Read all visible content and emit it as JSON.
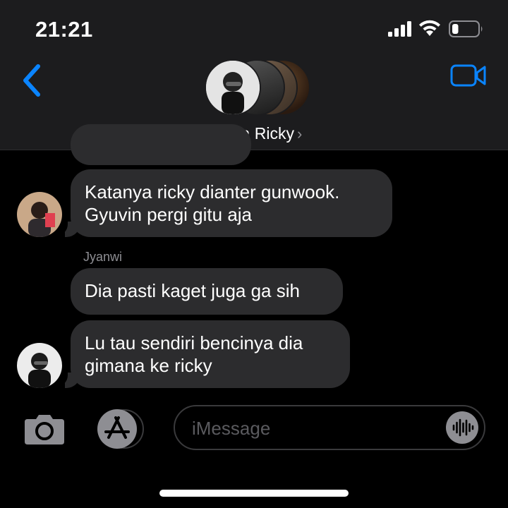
{
  "status_bar": {
    "time": "21:21",
    "battery_level": 0.25
  },
  "header": {
    "title": "Tanpa Ricky",
    "title_chevron": "›",
    "icons": [
      "back-chevron-icon",
      "video-camera-icon"
    ]
  },
  "messages": [
    {
      "text_lines": [
        "Katanya ricky dianter gunwook.",
        "Gyuvin pergi gitu aja"
      ]
    },
    {
      "sender": "Jyanwi",
      "text_lines": [
        "Dia pasti kaget juga ga sih"
      ]
    },
    {
      "text_lines": [
        "Lu tau sendiri bencinya dia",
        "gimana ke ricky"
      ]
    }
  ],
  "composer": {
    "placeholder": "iMessage",
    "icons": [
      "camera-icon",
      "app-store-icon",
      "audio-waveform-icon"
    ]
  },
  "colors": {
    "accent": "#0a84ff",
    "bubble": "#2c2c2e",
    "header_bg": "#1c1c1e",
    "secondary_text": "#8e8e93"
  }
}
